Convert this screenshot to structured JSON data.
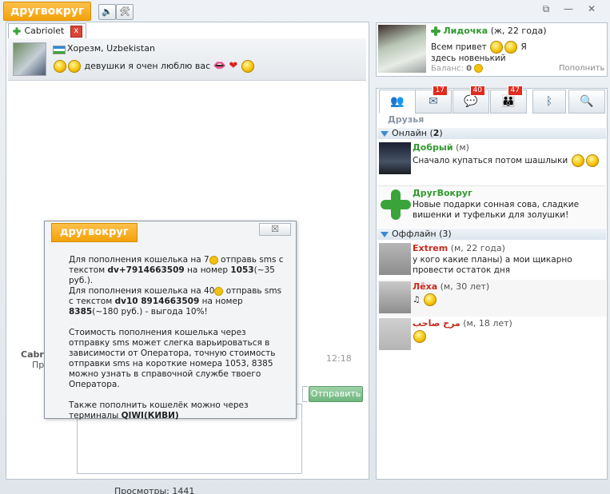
{
  "app": {
    "logo": "другвокруг",
    "win_controls": [
      "⧉",
      "—",
      "✕"
    ]
  },
  "toolbar": {
    "sound_icon": "🔈",
    "tools_icon": "🛠"
  },
  "chat": {
    "tab_label": "Cabriolet",
    "tab_close": "x",
    "location": "Хорезм, Uzbekistan",
    "status": "девушки я очен люблю вас",
    "prev_sender": "Cabri",
    "prev_line": "Пр",
    "prev_time": "12:18",
    "send_label": "Отправить",
    "bottom_text": "Просмотры: 1441"
  },
  "dialog": {
    "logo": "другвокруг",
    "close": "☒",
    "p1_a": "Для пополнения кошелька на 7",
    "p1_b": " отправь sms с текстом ",
    "p1_code": "dv+7914663509",
    "p1_c": " на номер ",
    "p1_num": "1053",
    "p1_d": "(~35 руб.).",
    "p2_a": "Для пополнения кошелька на 40",
    "p2_b": " отправь sms с текстом ",
    "p2_code": "dv10 8914663509",
    "p2_c": " на номер ",
    "p2_num": "8385",
    "p2_d": "(~180 руб.) - выгода 10%!",
    "p3": "Стоимость пополнения кошелька через отправку sms может слегка варьироваться в зависимости от Оператора, точную стоимость отправки sms на короткие номера 1053, 8385 можно узнать в справочной службе твоего Оператора.",
    "p4_a": "Также пополнить кошелёк можно через терминалы ",
    "p4_b": "QIWI(КИВИ)"
  },
  "profile": {
    "name": "Лидочка",
    "meta": "(ж, 22 года)",
    "status_a": "Всем привет",
    "status_b": "Я здесь новенький",
    "balance_label": "Баланс:",
    "balance_value": "0",
    "refill": "Пополнить"
  },
  "tabs": [
    {
      "name": "friends",
      "icon": "👥",
      "badge": ""
    },
    {
      "name": "messages",
      "icon": "✉",
      "badge": "17"
    },
    {
      "name": "chats",
      "icon": "💬",
      "badge": "40"
    },
    {
      "name": "people",
      "icon": "👪",
      "badge": "47"
    },
    {
      "name": "bluetooth",
      "icon": "ᛒ",
      "badge": ""
    },
    {
      "name": "search",
      "icon": "🔍",
      "badge": ""
    }
  ],
  "friends": {
    "title": "Друзья",
    "online_label": "Онлайн",
    "online_count": "2",
    "offline_label": "Оффлайн",
    "offline_count": "3",
    "online": [
      {
        "name": "Добрый",
        "meta": "(м)",
        "msg": "Сначало купаться потом шашлыки"
      },
      {
        "name": "ДругВокруг",
        "meta": "",
        "msg": "Новые подарки сонная сова, сладкие вишенки и туфельки для золушки!"
      }
    ],
    "offline": [
      {
        "name": "Extrem",
        "meta": "(м, 22 года)",
        "msg": "у кого какие планы) а мои щикарно провести остаток дня"
      },
      {
        "name": "Лёха",
        "meta": "(м, 30 лет)",
        "msg": "♫"
      },
      {
        "name": "مرح صاحب",
        "meta": "(м, 18 лет)",
        "msg": ""
      }
    ]
  }
}
